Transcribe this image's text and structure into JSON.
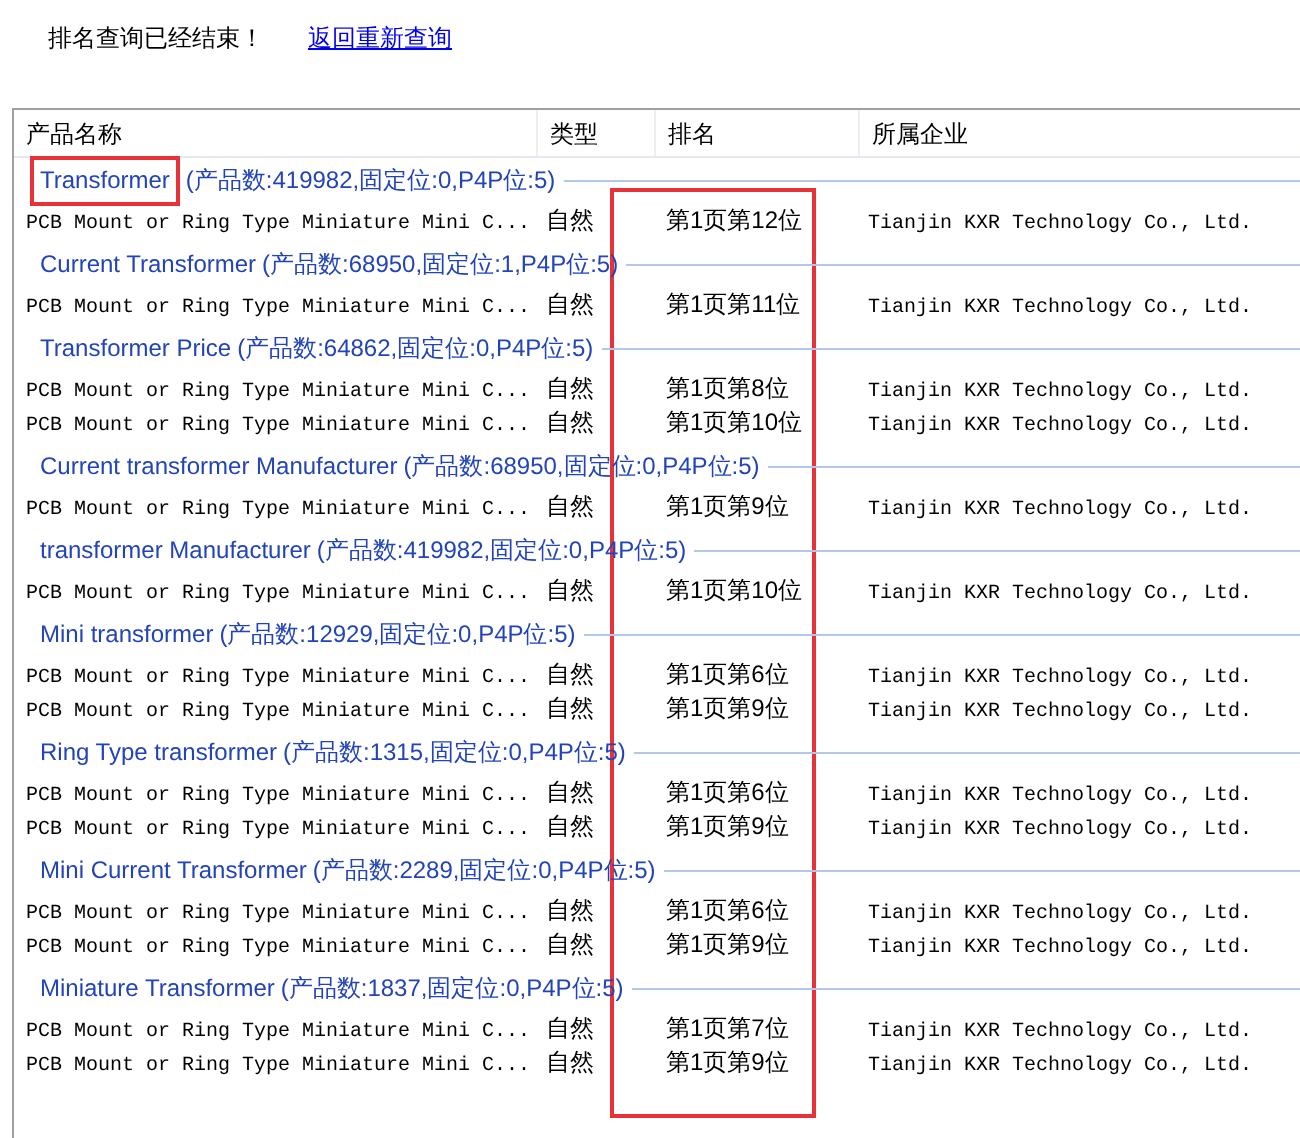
{
  "notice": "排名查询已经结束！",
  "back_link": "返回重新查询",
  "columns": [
    "产品名称",
    "类型",
    "排名",
    "所属企业"
  ],
  "groups": [
    {
      "keyword": "Transformer",
      "highlighted": true,
      "stats": "(产品数:419982,固定位:0,P4P位:5)",
      "rows": [
        {
          "name": "PCB Mount or Ring Type Miniature Mini C...",
          "type": "自然",
          "rank": "第1页第12位",
          "company": "Tianjin KXR Technology Co., Ltd."
        }
      ]
    },
    {
      "keyword": "Current Transformer",
      "highlighted": false,
      "stats": "(产品数:68950,固定位:1,P4P位:5)",
      "rows": [
        {
          "name": "PCB Mount or Ring Type Miniature Mini C...",
          "type": "自然",
          "rank": "第1页第11位",
          "company": "Tianjin KXR Technology Co., Ltd."
        }
      ]
    },
    {
      "keyword": "Transformer Price",
      "highlighted": false,
      "stats": "(产品数:64862,固定位:0,P4P位:5)",
      "rows": [
        {
          "name": "PCB Mount or Ring Type Miniature Mini C...",
          "type": "自然",
          "rank": "第1页第8位",
          "company": "Tianjin KXR Technology Co., Ltd."
        },
        {
          "name": "PCB Mount or Ring Type Miniature Mini C...",
          "type": "自然",
          "rank": "第1页第10位",
          "company": "Tianjin KXR Technology Co., Ltd."
        }
      ]
    },
    {
      "keyword": "Current transformer Manufacturer",
      "highlighted": false,
      "stats": "(产品数:68950,固定位:0,P4P位:5)",
      "rows": [
        {
          "name": "PCB Mount or Ring Type Miniature Mini C...",
          "type": "自然",
          "rank": "第1页第9位",
          "company": "Tianjin KXR Technology Co., Ltd."
        }
      ]
    },
    {
      "keyword": "transformer Manufacturer",
      "highlighted": false,
      "stats": "(产品数:419982,固定位:0,P4P位:5)",
      "rows": [
        {
          "name": "PCB Mount or Ring Type Miniature Mini C...",
          "type": "自然",
          "rank": "第1页第10位",
          "company": "Tianjin KXR Technology Co., Ltd."
        }
      ]
    },
    {
      "keyword": "Mini transformer",
      "highlighted": false,
      "stats": "(产品数:12929,固定位:0,P4P位:5)",
      "rows": [
        {
          "name": "PCB Mount or Ring Type Miniature Mini C...",
          "type": "自然",
          "rank": "第1页第6位",
          "company": "Tianjin KXR Technology Co., Ltd."
        },
        {
          "name": "PCB Mount or Ring Type Miniature Mini C...",
          "type": "自然",
          "rank": "第1页第9位",
          "company": "Tianjin KXR Technology Co., Ltd."
        }
      ]
    },
    {
      "keyword": "Ring Type transformer",
      "highlighted": false,
      "stats": "(产品数:1315,固定位:0,P4P位:5)",
      "rows": [
        {
          "name": "PCB Mount or Ring Type Miniature Mini C...",
          "type": "自然",
          "rank": "第1页第6位",
          "company": "Tianjin KXR Technology Co., Ltd."
        },
        {
          "name": "PCB Mount or Ring Type Miniature Mini C...",
          "type": "自然",
          "rank": "第1页第9位",
          "company": "Tianjin KXR Technology Co., Ltd."
        }
      ]
    },
    {
      "keyword": "Mini Current Transformer",
      "highlighted": false,
      "stats": "(产品数:2289,固定位:0,P4P位:5)",
      "rows": [
        {
          "name": "PCB Mount or Ring Type Miniature Mini C...",
          "type": "自然",
          "rank": "第1页第6位",
          "company": "Tianjin KXR Technology Co., Ltd."
        },
        {
          "name": "PCB Mount or Ring Type Miniature Mini C...",
          "type": "自然",
          "rank": "第1页第9位",
          "company": "Tianjin KXR Technology Co., Ltd."
        }
      ]
    },
    {
      "keyword": "Miniature Transformer",
      "highlighted": false,
      "stats": "(产品数:1837,固定位:0,P4P位:5)",
      "rows": [
        {
          "name": "PCB Mount or Ring Type Miniature Mini C...",
          "type": "自然",
          "rank": "第1页第7位",
          "company": "Tianjin KXR Technology Co., Ltd."
        },
        {
          "name": "PCB Mount or Ring Type Miniature Mini C...",
          "type": "自然",
          "rank": "第1页第9位",
          "company": "Tianjin KXR Technology Co., Ltd."
        }
      ]
    }
  ]
}
